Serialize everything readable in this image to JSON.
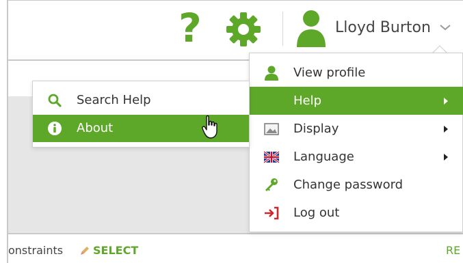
{
  "header": {
    "help_glyph": "?",
    "user_name": "Lloyd Burton"
  },
  "user_menu": {
    "items": [
      {
        "label": "View profile",
        "icon": "user-icon"
      },
      {
        "label": "Help",
        "icon": "",
        "submenu": true,
        "active": true
      },
      {
        "label": "Display",
        "icon": "display-icon",
        "submenu": true
      },
      {
        "label": "Language",
        "icon": "uk-flag-icon",
        "submenu": true
      },
      {
        "label": "Change password",
        "icon": "key-icon"
      },
      {
        "label": "Log out",
        "icon": "logout-icon"
      }
    ]
  },
  "help_menu": {
    "items": [
      {
        "label": "Search Help",
        "icon": "search-icon"
      },
      {
        "label": "About",
        "icon": "info-icon",
        "active": true
      }
    ]
  },
  "content": {
    "constraints_label": "onstraints",
    "select_label": "SELECT",
    "right_link": "RE"
  },
  "colors": {
    "accent": "#5ea829",
    "logout": "#d0252b",
    "border": "#c9c9c9"
  }
}
